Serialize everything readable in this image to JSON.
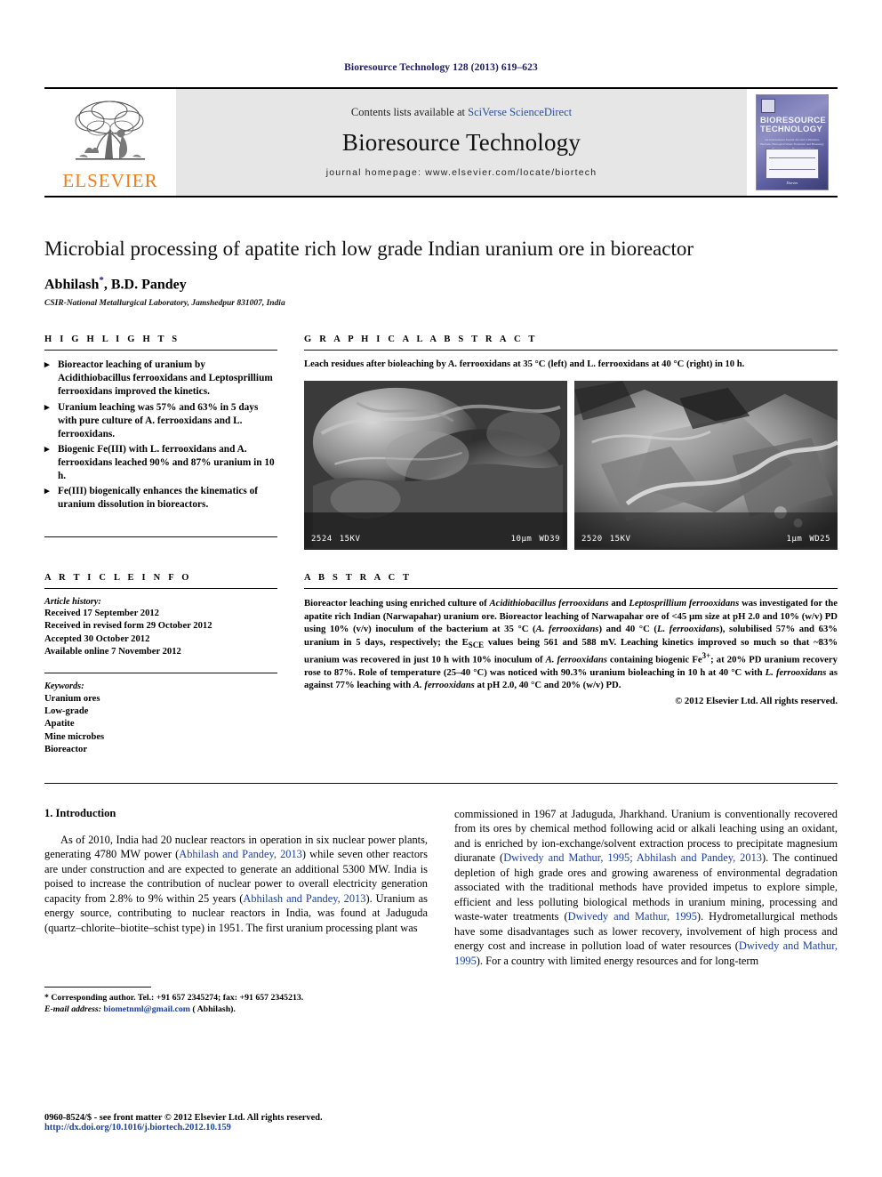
{
  "running_head": "Bioresource Technology 128 (2013) 619–623",
  "masthead": {
    "publisher_name": "ELSEVIER",
    "publisher_logo_icon": "elsevier-tree-icon",
    "contents_prefix": "Contents lists available at ",
    "contents_link": "SciVerse ScienceDirect",
    "journal_name": "Bioresource Technology",
    "homepage": "journal homepage: www.elsevier.com/locate/biortech",
    "cover": {
      "title_line1": "BIORESOURCE",
      "title_line2": "TECHNOLOGY",
      "subtitle": "An International Journal devoted to Biomass, Biofuels, Biological Waste Treatment and Bioenergy · Bioconversion · Biotransformation",
      "footer": "Elsevier"
    }
  },
  "article": {
    "title": "Microbial processing of apatite rich low grade Indian uranium ore in bioreactor",
    "authors": "Abhilash",
    "authors_rest": ", B.D. Pandey",
    "corresponding_marker": "*",
    "affiliation": "CSIR-National Metallurgical Laboratory, Jamshedpur 831007, India"
  },
  "highlights": {
    "heading": "H I G H L I G H T S",
    "items": [
      "Bioreactor leaching of uranium by Acidithiobacillus ferrooxidans and Leptosprillium ferrooxidans improved the kinetics.",
      "Uranium leaching was 57% and 63% in 5 days with pure culture of A. ferrooxidans and L. ferrooxidans.",
      "Biogenic Fe(III) with L. ferrooxidans and A. ferrooxidans leached 90% and 87% uranium in 10 h.",
      "Fe(III) biogenically enhances the kinematics of uranium dissolution in bioreactors."
    ]
  },
  "graphical_abstract": {
    "heading": "G R A P H I C A L   A B S T R A C T",
    "caption": "Leach residues after bioleaching by A. ferrooxidans at 35 °C (left) and L. ferrooxidans at 40 °C (right) in 10 h.",
    "images": [
      {
        "name": "sem-micrograph-left",
        "id": "2524",
        "voltage": "15KV",
        "scale": "10μm",
        "wd": "WD39"
      },
      {
        "name": "sem-micrograph-right",
        "id": "2520",
        "voltage": "15KV",
        "scale": "1μm",
        "wd": "WD25"
      }
    ]
  },
  "article_info": {
    "heading": "A R T I C L E   I N F O",
    "history_label": "Article history:",
    "history": [
      "Received 17 September 2012",
      "Received in revised form 29 October 2012",
      "Accepted 30 October 2012",
      "Available online 7 November 2012"
    ],
    "keywords_label": "Keywords:",
    "keywords": [
      "Uranium ores",
      "Low-grade",
      "Apatite",
      "Mine microbes",
      "Bioreactor"
    ]
  },
  "abstract": {
    "heading": "A B S T R A C T",
    "text_part1": "Bioreactor leaching using enriched culture of ",
    "sp1": "Acidithiobacillus ferrooxidans",
    "text_part2": " and ",
    "sp2": "Leptosprillium ferrooxidans",
    "text_part3": " was investigated for the apatite rich Indian (Narwapahar) uranium ore. Bioreactor leaching of Narwapahar ore of <45 μm size at pH 2.0 and 10% (w/v) PD using 10% (v/v) inoculum of the bacterium at 35 °C (",
    "sp3": "A. ferrooxidans",
    "text_part4": ") and 40 °C (",
    "sp4": "L. ferrooxidans",
    "text_part5": "), solubilised 57% and 63% uranium in 5 days, respectively; the E",
    "esce_sub": "SCE",
    "text_part6": " values being 561 and 588 mV. Leaching kinetics improved so much so that ~83% uranium was recovered in just 10 h with 10% inoculum of ",
    "sp5": "A. ferrooxidans",
    "text_part7": " containing biogenic Fe",
    "fe_sup": "3+",
    "text_part8": "; at 20% PD uranium recovery rose to 87%. Role of temperature (25–40 °C) was noticed with 90.3% uranium bioleaching in 10 h at 40 °C with ",
    "sp6": "L. ferrooxidans",
    "text_part9": " as against 77% leaching with ",
    "sp7": "A. ferrooxidans",
    "text_part10": " at pH 2.0, 40 °C and 20% (w/v) PD.",
    "copyright": "© 2012 Elsevier Ltd. All rights reserved."
  },
  "introduction": {
    "heading": "1. Introduction",
    "left_p1": "As of 2010, India had 20 nuclear reactors in operation in six nuclear power plants, generating 4780 MW power (",
    "left_cite1": "Abhilash and Pandey, 2013",
    "left_p2": ") while seven other reactors are under construction and are expected to generate an additional 5300 MW. India is poised to increase the contribution of nuclear power to overall electricity generation capacity from 2.8% to 9% within 25 years (",
    "left_cite2": "Abhilash and Pandey, 2013",
    "left_p3": "). Uranium as energy source, contributing to nuclear reactors in India, was found at Jaduguda (quartz–chlorite–biotite–schist type) in 1951. The first uranium processing plant was",
    "right_p1": "commissioned in 1967 at Jaduguda, Jharkhand. Uranium is conventionally recovered from its ores by chemical method following acid or alkali leaching using an oxidant, and is enriched by ion-exchange/solvent extraction process to precipitate magnesium diuranate (",
    "right_cite1": "Dwivedy and Mathur, 1995; Abhilash and Pandey, 2013",
    "right_p2": "). The continued depletion of high grade ores and growing awareness of environmental degradation associated with the traditional methods have provided impetus to explore simple, efficient and less polluting biological methods in uranium mining, processing and waste-water treatments (",
    "right_cite2": "Dwivedy and Mathur, 1995",
    "right_p3": "). Hydrometallurgical methods have some disadvantages such as lower recovery, involvement of high process and energy cost and increase in pollution load of water resources (",
    "right_cite3": "Dwivedy and Mathur, 1995",
    "right_p4": "). For a country with limited energy resources and for long-term"
  },
  "footnote": {
    "marker": "*",
    "line1": " Corresponding author. Tel.: +91 657 2345274; fax: +91 657 2345213.",
    "email_label": "E-mail address:",
    "email": "biometnml@gmail.com",
    "email_suffix": " ( Abhilash)."
  },
  "footer": {
    "issn_line": "0960-8524/$ - see front matter © 2012 Elsevier Ltd. All rights reserved.",
    "doi": "http://dx.doi.org/10.1016/j.biortech.2012.10.159"
  },
  "colors": {
    "journal_navy": "#1b1b63",
    "link_blue": "#2b4ea2",
    "cite_blue": "#1b3fa0",
    "elsevier_orange": "#ef7d1a",
    "masthead_gray": "#e6e6e6"
  }
}
